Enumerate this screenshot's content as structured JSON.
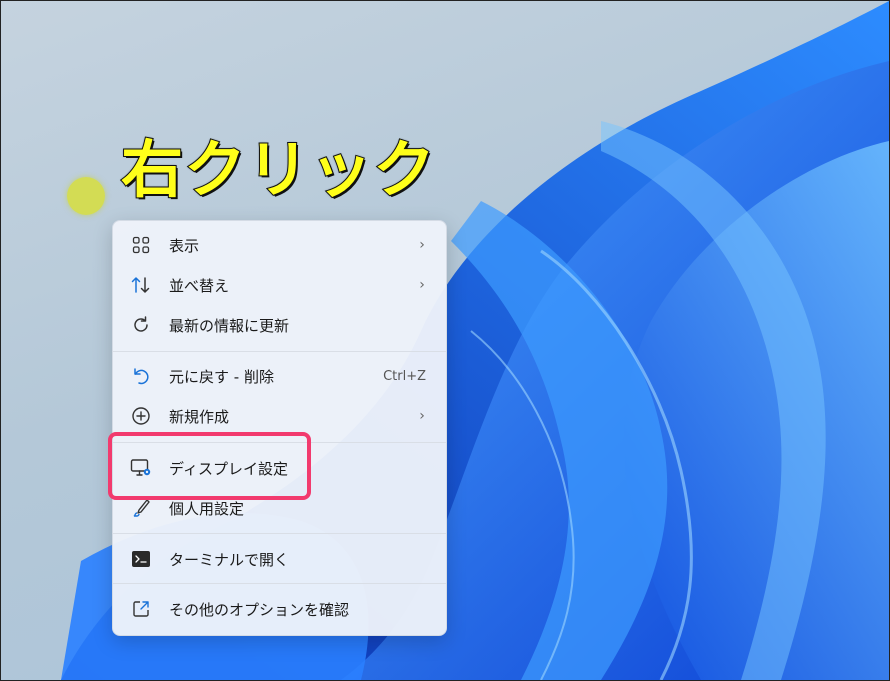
{
  "annotation": {
    "text": "右クリック",
    "color": "#ffff1a"
  },
  "highlight_color": "#f23a6e",
  "accent_color": "#1a73d8",
  "context_menu": {
    "items": [
      {
        "label": "表示",
        "icon": "grid-icon",
        "submenu": true
      },
      {
        "label": "並べ替え",
        "icon": "sort-icon",
        "submenu": true
      },
      {
        "label": "最新の情報に更新",
        "icon": "refresh-icon",
        "submenu": false
      },
      {
        "label": "元に戻す - 削除",
        "icon": "undo-icon",
        "shortcut": "Ctrl+Z"
      },
      {
        "label": "新規作成",
        "icon": "add-circle-icon",
        "submenu": true
      },
      {
        "label": "ディスプレイ設定",
        "icon": "display-settings-icon",
        "submenu": false
      },
      {
        "label": "個人用設定",
        "icon": "brush-icon",
        "submenu": false
      },
      {
        "label": "ターミナルで開く",
        "icon": "terminal-icon",
        "submenu": false
      },
      {
        "label": "その他のオプションを確認",
        "icon": "share-icon",
        "submenu": false
      }
    ]
  }
}
